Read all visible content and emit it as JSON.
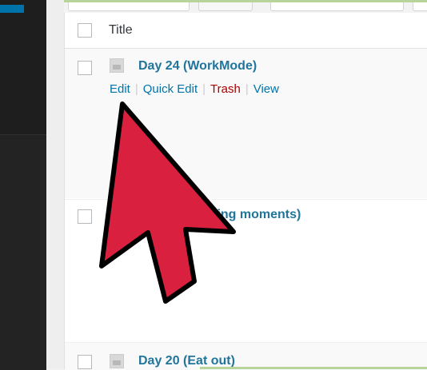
{
  "table": {
    "column_title": "Title"
  },
  "rows": [
    {
      "title": "Day 24 (WorkMode)",
      "actions": {
        "edit": "Edit",
        "quick_edit": "Quick Edit",
        "trash": "Trash",
        "view": "View"
      }
    },
    {
      "title_partial": "ling moments)"
    },
    {
      "title": "Day 20 (Eat out)"
    }
  ],
  "colors": {
    "link": "#0073aa",
    "trash": "#aa0000",
    "arrow_fill": "#d9213f",
    "arrow_stroke": "#000000"
  }
}
